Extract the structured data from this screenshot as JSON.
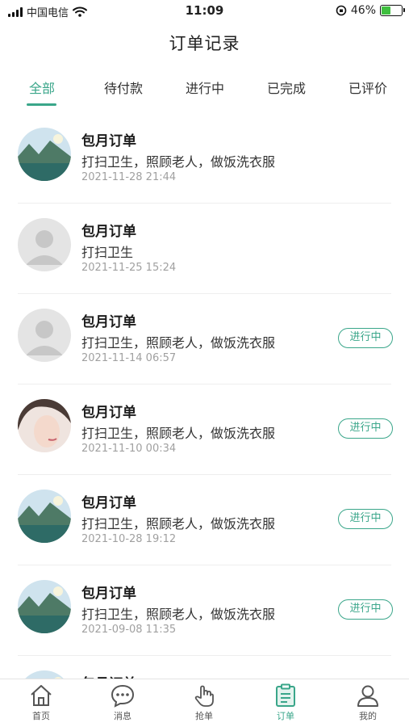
{
  "status_bar": {
    "carrier": "中国电信",
    "time": "11:09",
    "battery": "46%"
  },
  "page_title": "订单记录",
  "tabs": [
    {
      "label": "全部",
      "active": true
    },
    {
      "label": "待付款"
    },
    {
      "label": "进行中"
    },
    {
      "label": "已完成"
    },
    {
      "label": "已评价"
    }
  ],
  "orders": [
    {
      "title": "包月订单",
      "desc": "打扫卫生，照顾老人，做饭洗衣服",
      "time": "2021-11-28 21:44",
      "status": "",
      "avatar": "landscape"
    },
    {
      "title": "包月订单",
      "desc": "打扫卫生",
      "time": "2021-11-25 15:24",
      "status": "",
      "avatar": "placeholder"
    },
    {
      "title": "包月订单",
      "desc": "打扫卫生，照顾老人，做饭洗衣服",
      "time": "2021-11-14 06:57",
      "status": "进行中",
      "avatar": "placeholder"
    },
    {
      "title": "包月订单",
      "desc": "打扫卫生，照顾老人，做饭洗衣服",
      "time": "2021-11-10 00:34",
      "status": "进行中",
      "avatar": "person"
    },
    {
      "title": "包月订单",
      "desc": "打扫卫生，照顾老人，做饭洗衣服",
      "time": "2021-10-28 19:12",
      "status": "进行中",
      "avatar": "landscape"
    },
    {
      "title": "包月订单",
      "desc": "打扫卫生，照顾老人，做饭洗衣服",
      "time": "2021-09-08 11:35",
      "status": "进行中",
      "avatar": "landscape"
    },
    {
      "title": "包月订单",
      "desc": "",
      "time": "",
      "status": "",
      "avatar": "landscape"
    }
  ],
  "bottom_nav": [
    {
      "label": "首页",
      "icon": "home-icon"
    },
    {
      "label": "消息",
      "icon": "message-icon"
    },
    {
      "label": "抢单",
      "icon": "grab-order-icon"
    },
    {
      "label": "订单",
      "icon": "order-icon",
      "active": true
    },
    {
      "label": "我的",
      "icon": "profile-icon"
    }
  ],
  "colors": {
    "accent": "#3aa68a",
    "text_secondary": "#a0a0a0"
  }
}
